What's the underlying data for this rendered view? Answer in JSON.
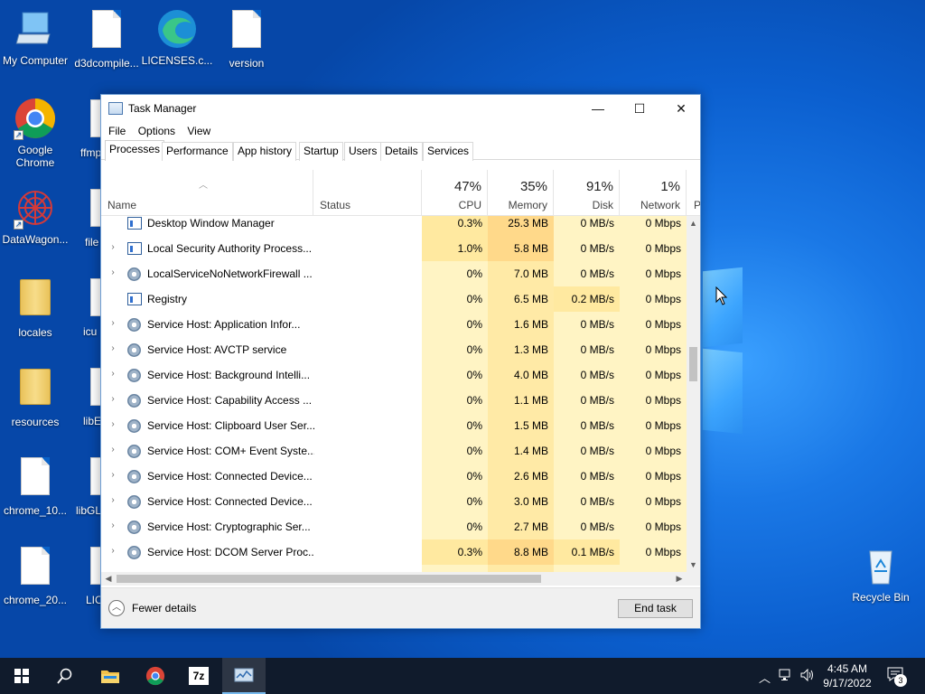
{
  "desktop": {
    "icons": [
      {
        "label": "My Computer",
        "icon": "computer-icon"
      },
      {
        "label": "d3dcompile...",
        "icon": "settings-file-icon"
      },
      {
        "label": "LICENSES.c...",
        "icon": "edge-icon"
      },
      {
        "label": "version",
        "icon": "text-file-icon"
      },
      {
        "label": "Google Chrome",
        "icon": "chrome-icon"
      },
      {
        "label": "ffmp",
        "icon": "settings-file-icon"
      },
      {
        "label": "DataWagon...",
        "icon": "datawagon-icon"
      },
      {
        "label": "file",
        "icon": "file-icon"
      },
      {
        "label": "locales",
        "icon": "folder-icon"
      },
      {
        "label": "icu",
        "icon": "file-icon"
      },
      {
        "label": "resources",
        "icon": "folder-icon"
      },
      {
        "label": "libE",
        "icon": "file-icon"
      },
      {
        "label": "chrome_10...",
        "icon": "file-icon"
      },
      {
        "label": "libGL",
        "icon": "file-icon"
      },
      {
        "label": "chrome_20...",
        "icon": "file-icon"
      },
      {
        "label": "LIC",
        "icon": "file-icon"
      },
      {
        "label": "Recycle Bin",
        "icon": "recycle-bin-icon"
      }
    ]
  },
  "window": {
    "title": "Task Manager",
    "controls": {
      "minimize": "—",
      "maximize": "☐",
      "close": "✕"
    },
    "menu": [
      "File",
      "Options",
      "View"
    ],
    "tabs": [
      "Processes",
      "Performance",
      "App history",
      "Startup",
      "Users",
      "Details",
      "Services"
    ],
    "active_tab": "Processes",
    "columns": {
      "name": "Name",
      "status": "Status",
      "cpu": {
        "pct": "47%",
        "label": "CPU"
      },
      "memory": {
        "pct": "35%",
        "label": "Memory"
      },
      "disk": {
        "pct": "91%",
        "label": "Disk"
      },
      "network": {
        "pct": "1%",
        "label": "Network"
      },
      "power": "P"
    },
    "processes": [
      {
        "name": "Desktop Window Manager",
        "expand": "",
        "icon": "window-process-icon",
        "cpu": "0.3%",
        "mem": "25.3 MB",
        "disk": "0 MB/s",
        "net": "0 Mbps",
        "hot": true
      },
      {
        "name": "Local Security Authority Process...",
        "expand": "›",
        "icon": "window-process-icon",
        "cpu": "1.0%",
        "mem": "5.8 MB",
        "disk": "0 MB/s",
        "net": "0 Mbps",
        "hot": true
      },
      {
        "name": "LocalServiceNoNetworkFirewall ...",
        "expand": "›",
        "icon": "gear-process-icon",
        "cpu": "0%",
        "mem": "7.0 MB",
        "disk": "0 MB/s",
        "net": "0 Mbps",
        "hot": false
      },
      {
        "name": "Registry",
        "expand": "",
        "icon": "window-process-icon",
        "cpu": "0%",
        "mem": "6.5 MB",
        "disk": "0.2 MB/s",
        "net": "0 Mbps",
        "hot": false,
        "diskhot": true
      },
      {
        "name": "Service Host: Application Infor...",
        "expand": "›",
        "icon": "gear-process-icon",
        "cpu": "0%",
        "mem": "1.6 MB",
        "disk": "0 MB/s",
        "net": "0 Mbps",
        "hot": false
      },
      {
        "name": "Service Host: AVCTP service",
        "expand": "›",
        "icon": "gear-process-icon",
        "cpu": "0%",
        "mem": "1.3 MB",
        "disk": "0 MB/s",
        "net": "0 Mbps",
        "hot": false
      },
      {
        "name": "Service Host: Background Intelli...",
        "expand": "›",
        "icon": "gear-process-icon",
        "cpu": "0%",
        "mem": "4.0 MB",
        "disk": "0 MB/s",
        "net": "0 Mbps",
        "hot": false
      },
      {
        "name": "Service Host: Capability Access ...",
        "expand": "›",
        "icon": "gear-process-icon",
        "cpu": "0%",
        "mem": "1.1 MB",
        "disk": "0 MB/s",
        "net": "0 Mbps",
        "hot": false
      },
      {
        "name": "Service Host: Clipboard User Ser...",
        "expand": "›",
        "icon": "gear-process-icon",
        "cpu": "0%",
        "mem": "1.5 MB",
        "disk": "0 MB/s",
        "net": "0 Mbps",
        "hot": false
      },
      {
        "name": "Service Host: COM+ Event Syste...",
        "expand": "›",
        "icon": "gear-process-icon",
        "cpu": "0%",
        "mem": "1.4 MB",
        "disk": "0 MB/s",
        "net": "0 Mbps",
        "hot": false
      },
      {
        "name": "Service Host: Connected Device...",
        "expand": "›",
        "icon": "gear-process-icon",
        "cpu": "0%",
        "mem": "2.6 MB",
        "disk": "0 MB/s",
        "net": "0 Mbps",
        "hot": false
      },
      {
        "name": "Service Host: Connected Device...",
        "expand": "›",
        "icon": "gear-process-icon",
        "cpu": "0%",
        "mem": "3.0 MB",
        "disk": "0 MB/s",
        "net": "0 Mbps",
        "hot": false
      },
      {
        "name": "Service Host: Cryptographic Ser...",
        "expand": "›",
        "icon": "gear-process-icon",
        "cpu": "0%",
        "mem": "2.7 MB",
        "disk": "0 MB/s",
        "net": "0 Mbps",
        "hot": false
      },
      {
        "name": "Service Host: DCOM Server Proc...",
        "expand": "›",
        "icon": "gear-process-icon",
        "cpu": "0.3%",
        "mem": "8.8 MB",
        "disk": "0.1 MB/s",
        "net": "0 Mbps",
        "hot": true,
        "diskhot": true
      }
    ],
    "footer": {
      "fewer_details": "Fewer details",
      "end_task": "End task"
    }
  },
  "taskbar": {
    "pinned": [
      {
        "name": "start-button",
        "icon": "windows-logo-icon"
      },
      {
        "name": "search-button",
        "icon": "search-icon"
      },
      {
        "name": "file-explorer-button",
        "icon": "folder-icon"
      },
      {
        "name": "chrome-button",
        "icon": "chrome-icon"
      },
      {
        "name": "7zip-button",
        "icon": "7zip-icon",
        "label": "7z"
      },
      {
        "name": "task-manager-button",
        "icon": "task-manager-icon"
      }
    ],
    "time": "4:45 AM",
    "date": "9/17/2022",
    "notification_count": "3"
  },
  "colors": {
    "accent": "#0b63c9",
    "taskbar": "#101b2c",
    "heat_low": "#fff4c4",
    "heat_mid": "#ffe9a0"
  }
}
